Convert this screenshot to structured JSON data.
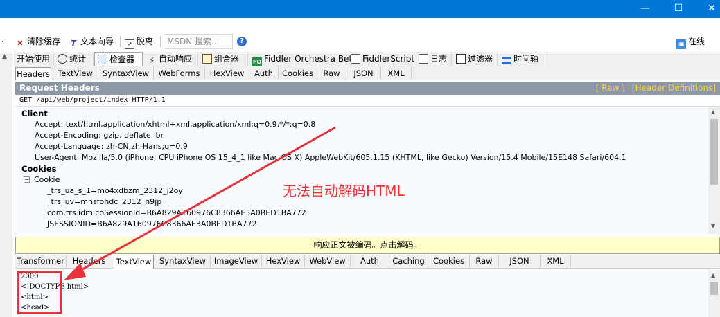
{
  "toolbar": {
    "clear_cache": "清除缓存",
    "text_wizard": "文本向导",
    "detach": "脱离",
    "search_placeholder": "MSDN 搜索...",
    "online": "在线"
  },
  "main_tabs": [
    {
      "label": "开始使用"
    },
    {
      "label": "统计"
    },
    {
      "label": "检查器"
    },
    {
      "label": "自动响应"
    },
    {
      "label": "组合器"
    },
    {
      "label": "Fiddler Orchestra Beta"
    },
    {
      "label": "FiddlerScript"
    },
    {
      "label": "日志"
    },
    {
      "label": "过滤器"
    },
    {
      "label": "时间轴"
    }
  ],
  "orchestra_badge": "FO",
  "request_tabs": [
    "Headers",
    "TextView",
    "SyntaxView",
    "WebForms",
    "HexView",
    "Auth",
    "Cookies",
    "Raw",
    "JSON",
    "XML"
  ],
  "request_header": {
    "title": "Request Headers",
    "raw_link": "[ Raw ]",
    "defs_link": "[Header Definitions]",
    "request_line": "GET /api/web/project/index HTTP/1.1"
  },
  "headers": {
    "client_group": "Client",
    "accept": "Accept: text/html,application/xhtml+xml,application/xml;q=0.9,*/*;q=0.8",
    "accept_encoding": "Accept-Encoding: gzip, deflate, br",
    "accept_language": "Accept-Language: zh-CN,zh-Hans;q=0.9",
    "user_agent": "User-Agent: Mozilla/5.0 (iPhone; CPU iPhone OS 15_4_1 like Mac OS X) AppleWebKit/605.1.15 (KHTML, like Gecko) Version/15.4 Mobile/15E148 Safari/604.1",
    "cookies_group": "Cookies",
    "cookie_node": "Cookie",
    "cookie_items": [
      "_trs_ua_s_1=mo4xdbzm_2312_j2oy",
      "_trs_uv=mnsfohdc_2312_h9jp",
      "com.trs.idm.coSessionId=B6A829A160976C8366AE3A0BED1BA772",
      "JSESSIONID=B6A829A160976C8366AE3A0BED1BA772"
    ]
  },
  "notice": "响应正文被编码。点击解码。",
  "response_tabs": [
    "Transformer",
    "Headers",
    "TextView",
    "SyntaxView",
    "ImageView",
    "HexView",
    "WebView",
    "Auth",
    "Caching",
    "Cookies",
    "Raw",
    "JSON",
    "XML"
  ],
  "response_body": [
    "2000",
    "<!DOCTYPE html>",
    "<html>",
    "<head>"
  ],
  "annotation": "无法自动解码HTML",
  "colors": {
    "titlebar": "#0078d7",
    "annotation_red": "#e8323b",
    "notice_bg": "#ffffc8",
    "header_bar": "#8e99a8",
    "link_gold": "#ffd24a"
  }
}
